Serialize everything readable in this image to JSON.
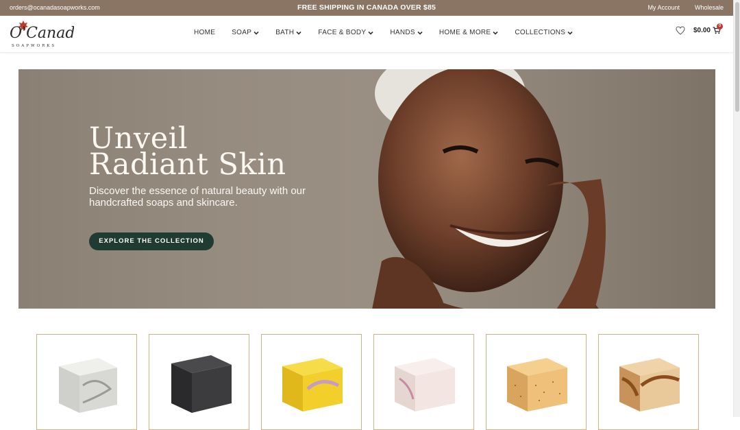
{
  "topbar": {
    "email": "orders@ocanadasoapworks.com",
    "promo": "FREE SHIPPING IN CANADA OVER $85",
    "links": [
      "My Account",
      "Wholesale"
    ]
  },
  "logo": {
    "name": "O'Canada",
    "tagline": "SOAPWORKS"
  },
  "nav": [
    {
      "label": "HOME",
      "dropdown": false
    },
    {
      "label": "SOAP",
      "dropdown": true
    },
    {
      "label": "BATH",
      "dropdown": true
    },
    {
      "label": "FACE & BODY",
      "dropdown": true
    },
    {
      "label": "HANDS",
      "dropdown": true
    },
    {
      "label": "HOME & MORE",
      "dropdown": true
    },
    {
      "label": "COLLECTIONS",
      "dropdown": true
    }
  ],
  "cart": {
    "total": "$0.00",
    "count": "0"
  },
  "hero": {
    "heading_line1": "Unveil",
    "heading_line2": "Radiant Skin",
    "subtext": "Discover the essence of natural beauty with our handcrafted soaps and skincare.",
    "cta_label": "EXPLORE THE COLLECTION"
  },
  "products": [
    {
      "name": "white-marble-soap",
      "color": "#d8d8d4",
      "accent": "#9a9a98"
    },
    {
      "name": "charcoal-soap",
      "color": "#3c3c3e",
      "accent": "#2a2a2c"
    },
    {
      "name": "yellow-swirl-soap",
      "color": "#f2cf2a",
      "accent": "#c79bc4"
    },
    {
      "name": "pink-marble-soap",
      "color": "#f3e6e2",
      "accent": "#c98aa0"
    },
    {
      "name": "oatmeal-soap",
      "color": "#eec07a",
      "accent": "#8a5a2e"
    },
    {
      "name": "caramel-swirl-soap",
      "color": "#e9c99a",
      "accent": "#8a4e1c"
    }
  ],
  "colors": {
    "topbar": "#8a7564",
    "cta": "#1f3b32",
    "card_border": "#c9b48a"
  }
}
